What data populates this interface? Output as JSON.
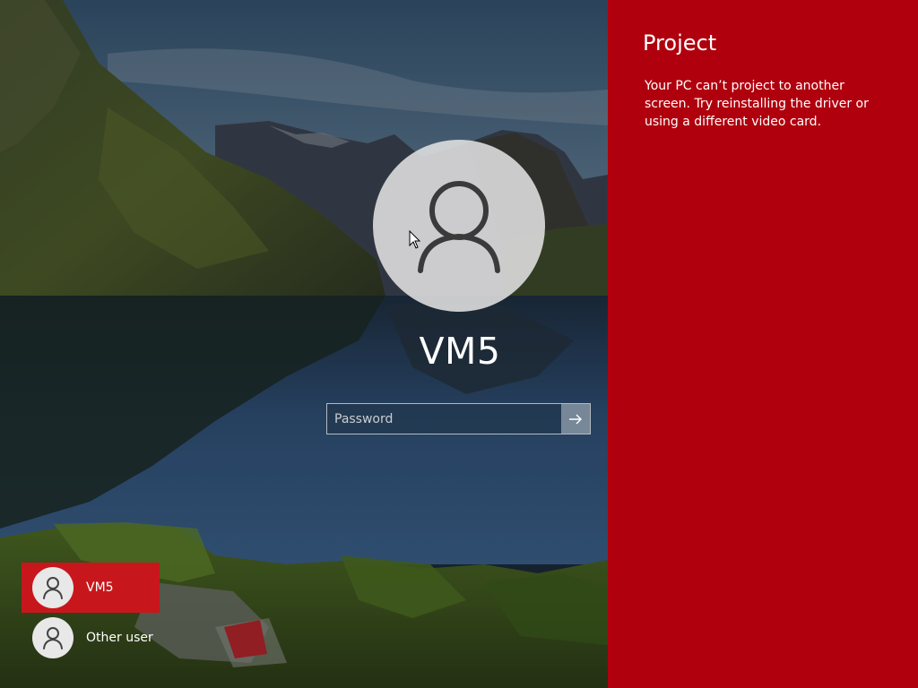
{
  "lock_screen": {
    "username": "VM5",
    "password_placeholder": "Password",
    "users": [
      {
        "name": "VM5",
        "selected": true
      },
      {
        "name": "Other user",
        "selected": false
      }
    ]
  },
  "project_panel": {
    "title": "Project",
    "message": "Your PC can’t project to another screen. Try reinstalling the driver or using a different video card."
  },
  "colors": {
    "panel_background": "#b0000e",
    "selected_user_highlight": "#c8171c",
    "avatar_background": "#e1e1e1"
  },
  "icons": {
    "user_avatar": "person-icon",
    "submit": "arrow-right-icon",
    "cursor": "mouse-pointer-icon"
  }
}
